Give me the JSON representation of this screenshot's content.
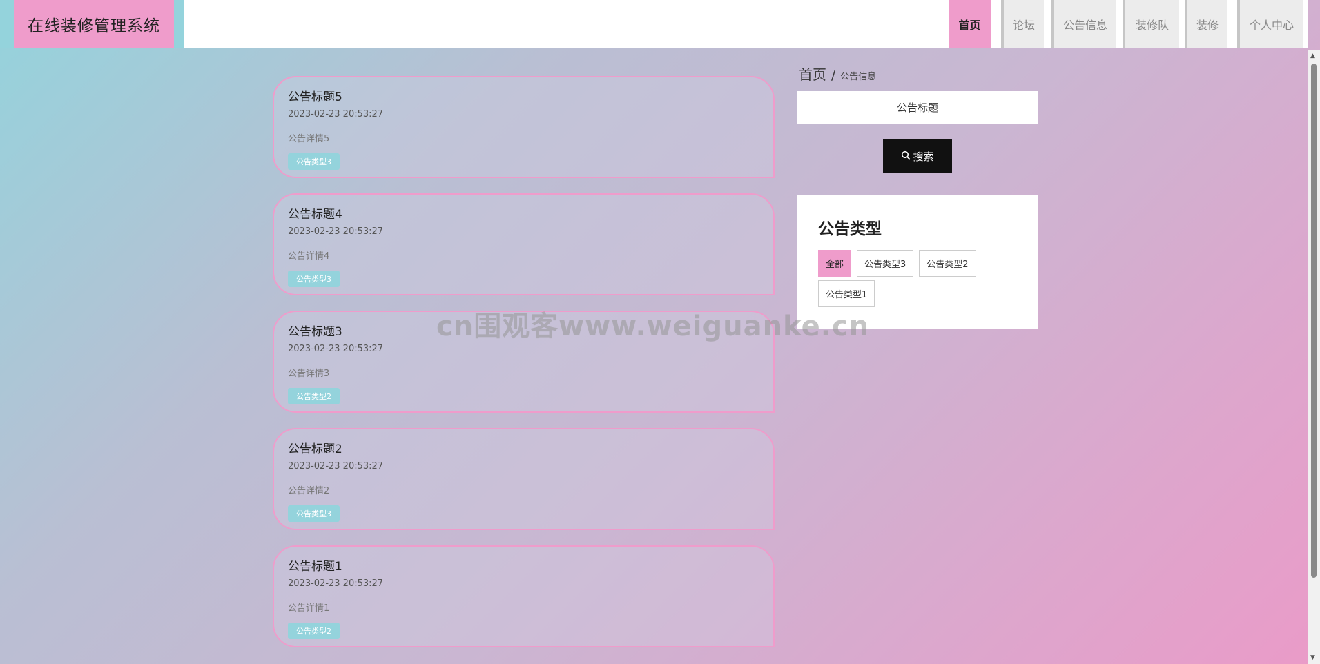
{
  "app": {
    "title": "在线装修管理系统"
  },
  "nav": {
    "items": [
      {
        "label": "首页",
        "active": true
      },
      {
        "label": "论坛"
      },
      {
        "label": "公告信息"
      },
      {
        "label": "装修队"
      },
      {
        "label": "装修"
      },
      {
        "label": "个人中心"
      }
    ]
  },
  "announcements": [
    {
      "title": "公告标题5",
      "time": "2023-02-23 20:53:27",
      "detail": "公告详情5",
      "type": "公告类型3"
    },
    {
      "title": "公告标题4",
      "time": "2023-02-23 20:53:27",
      "detail": "公告详情4",
      "type": "公告类型3"
    },
    {
      "title": "公告标题3",
      "time": "2023-02-23 20:53:27",
      "detail": "公告详情3",
      "type": "公告类型2"
    },
    {
      "title": "公告标题2",
      "time": "2023-02-23 20:53:27",
      "detail": "公告详情2",
      "type": "公告类型3"
    },
    {
      "title": "公告标题1",
      "time": "2023-02-23 20:53:27",
      "detail": "公告详情1",
      "type": "公告类型2"
    }
  ],
  "breadcrumb": {
    "home": "首页",
    "separator": "/",
    "current": "公告信息"
  },
  "search": {
    "placeholder": "公告标题",
    "button_label": "搜索",
    "icon": "search-icon"
  },
  "type_filter": {
    "heading": "公告类型",
    "options": [
      {
        "label": "全部",
        "active": true
      },
      {
        "label": "公告类型3"
      },
      {
        "label": "公告类型2"
      },
      {
        "label": "公告类型1"
      }
    ]
  },
  "watermark": "cn围观客www.weiguanke.cn",
  "colors": {
    "accent_pink": "#ef9ccb",
    "accent_cyan": "#94d3dc",
    "button_dark": "#111111"
  }
}
